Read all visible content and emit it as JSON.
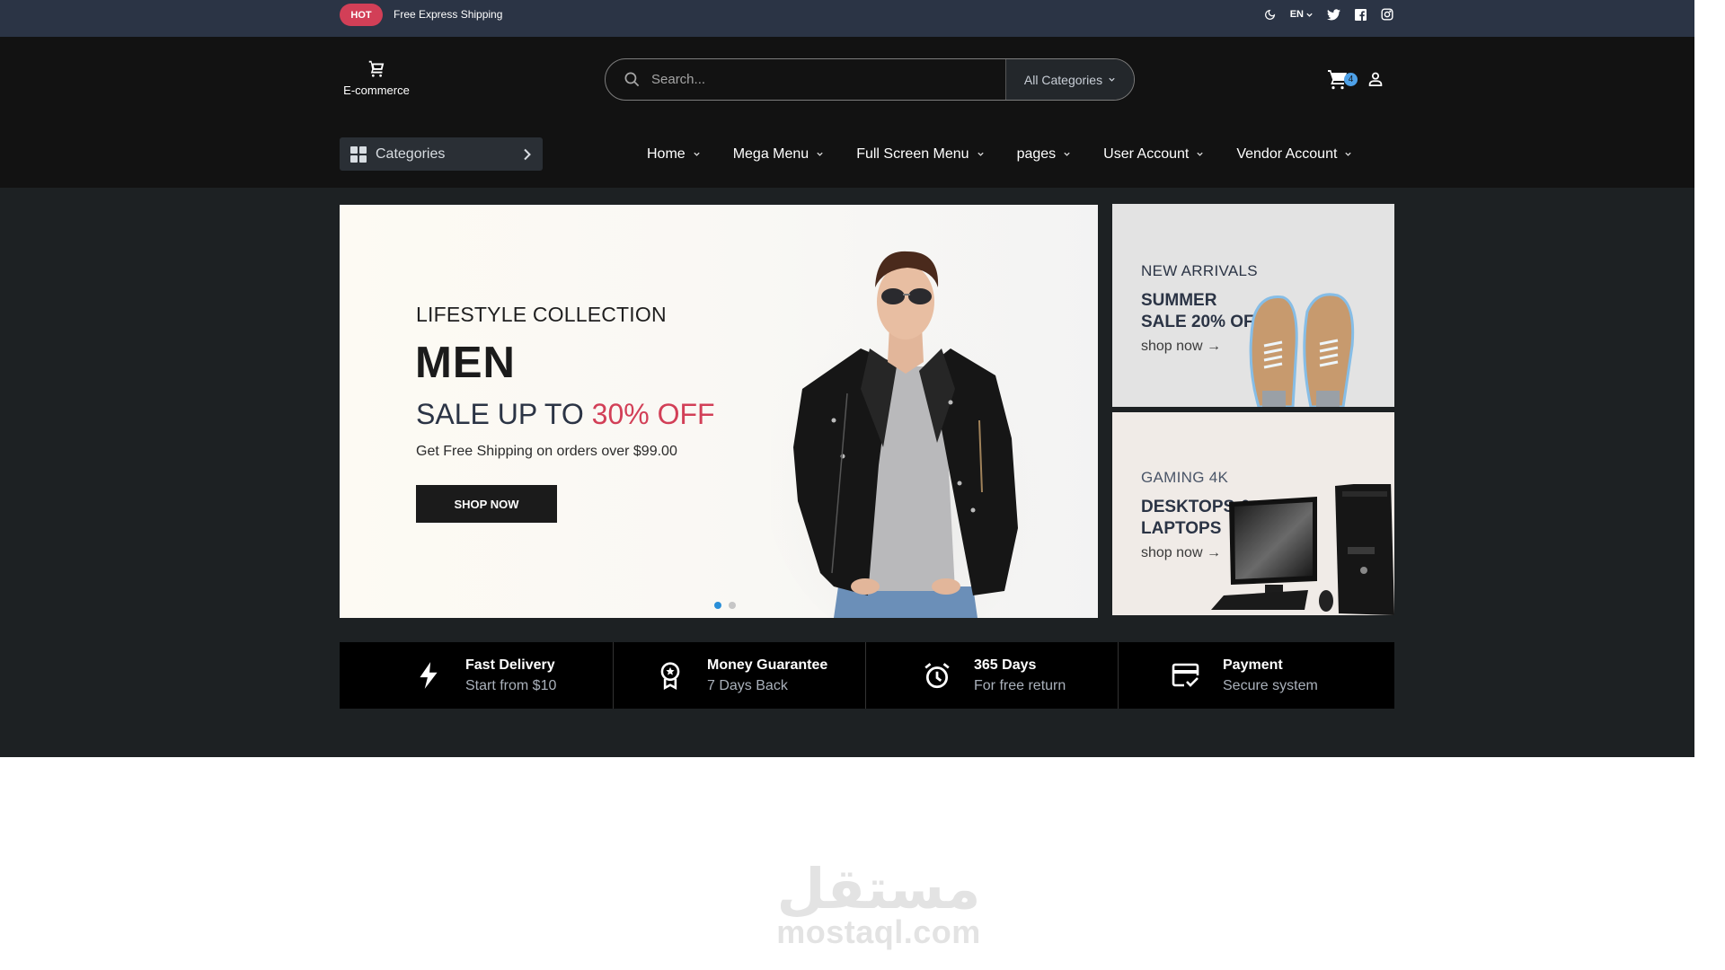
{
  "topbar": {
    "badge": "HOT",
    "promo_text": "Free Express Shipping",
    "language": "EN",
    "icons": [
      "moon-icon",
      "twitter-icon",
      "facebook-icon",
      "instagram-icon"
    ]
  },
  "header": {
    "logo_text": "E-commerce",
    "search": {
      "placeholder": "Search...",
      "value": "",
      "category_select": "All Categories"
    },
    "cart_count": "4",
    "categories_button": "Categories",
    "nav": [
      {
        "label": "Home"
      },
      {
        "label": "Mega Menu"
      },
      {
        "label": "Full Screen Menu"
      },
      {
        "label": "pages"
      },
      {
        "label": "User Account"
      },
      {
        "label": "Vendor Account"
      }
    ]
  },
  "hero": {
    "subtitle": "LIFESTYLE COLLECTION",
    "title": "MEN",
    "sale_prefix": "SALE UP TO ",
    "sale_highlight": "30% OFF",
    "description": "Get Free Shipping on orders over $99.00",
    "button_label": "SHOP NOW",
    "slides_total": 2,
    "active_slide": 1,
    "accent_color": "#d23f57"
  },
  "side_banners": [
    {
      "kicker": "NEW ARRIVALS",
      "title_line1": "SUMMER",
      "title_line2": "SALE 20% OFF",
      "link": "shop now →"
    },
    {
      "kicker": "GAMING 4K",
      "title_line1": "DESKTOPS &",
      "title_line2": "LAPTOPS",
      "link": "shop now →"
    }
  ],
  "features": [
    {
      "icon": "lightning-icon",
      "title": "Fast Delivery",
      "subtitle": "Start from $10"
    },
    {
      "icon": "award-badge-icon",
      "title": "Money Guarantee",
      "subtitle": "7 Days Back"
    },
    {
      "icon": "alarm-clock-icon",
      "title": "365 Days",
      "subtitle": "For free return"
    },
    {
      "icon": "credit-card-check-icon",
      "title": "Payment",
      "subtitle": "Secure system"
    }
  ],
  "watermark": {
    "arabic": "مستقل",
    "latin": "mostaql.com"
  }
}
